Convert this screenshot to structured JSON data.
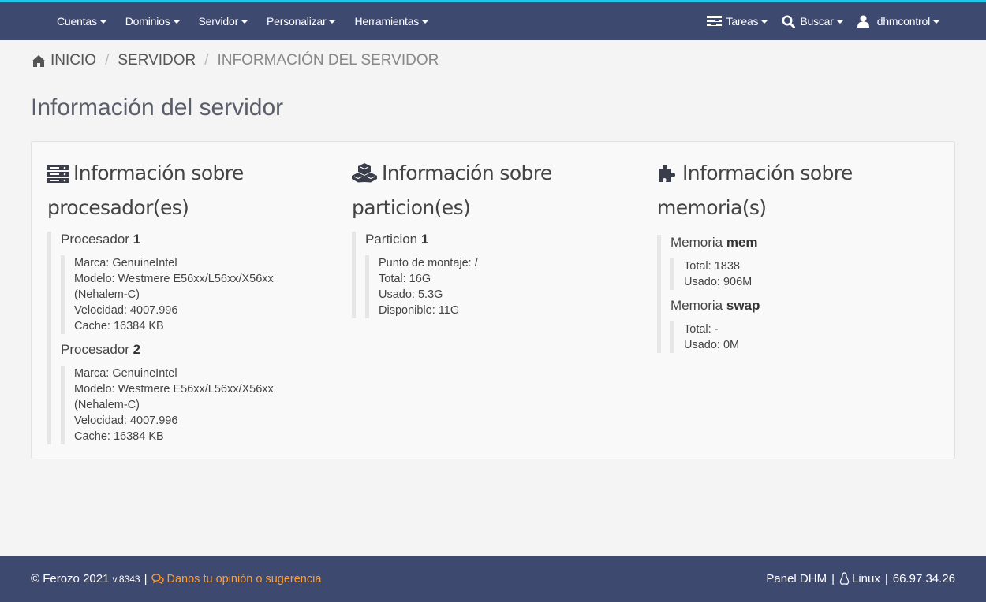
{
  "nav": {
    "left_items": [
      {
        "label": "Cuentas"
      },
      {
        "label": "Dominios"
      },
      {
        "label": "Servidor"
      },
      {
        "label": "Personalizar"
      },
      {
        "label": "Herramientas"
      }
    ],
    "tasks_label": "Tareas",
    "search_label": "Buscar",
    "user_label": "dhmcontrol",
    "accent_color": "#1fc8e6",
    "bar_color": "#3e4970"
  },
  "breadcrumb": {
    "home": "INICIO",
    "section": "SERVIDOR",
    "current": "INFORMACIÓN DEL SERVIDOR"
  },
  "page_title": "Información del servidor",
  "processors": {
    "title": "Información sobre procesador(es)",
    "icon": "server-icon",
    "items": [
      {
        "prefix": "Procesador",
        "number": "1",
        "brand": "Marca: GenuineIntel",
        "model": "Modelo: Westmere E56xx/L56xx/X56xx (Nehalem-C)",
        "speed": "Velocidad: 4007.996",
        "cache": "Cache: 16384 KB"
      },
      {
        "prefix": "Procesador",
        "number": "2",
        "brand": "Marca: GenuineIntel",
        "model": "Modelo: Westmere E56xx/L56xx/X56xx (Nehalem-C)",
        "speed": "Velocidad: 4007.996",
        "cache": "Cache: 16384 KB"
      }
    ]
  },
  "partitions": {
    "title": "Información sobre particion(es)",
    "icon": "cubes-icon",
    "items": [
      {
        "prefix": "Particion",
        "number": "1",
        "mount": "Punto de montaje: /",
        "total": "Total: 16G",
        "used": "Usado: 5.3G",
        "available": "Disponible: 11G"
      }
    ]
  },
  "memory": {
    "title": "Información sobre memoria(s)",
    "icon": "puzzle-icon",
    "items": [
      {
        "prefix": "Memoria",
        "name": "mem",
        "total": "Total: 1838",
        "used": "Usado: 906M"
      },
      {
        "prefix": "Memoria",
        "name": "swap",
        "total": "Total: -",
        "used": "Usado: 0M"
      }
    ]
  },
  "footer": {
    "copyright": "© Ferozo 2021",
    "version": "v.8343",
    "separator": "|",
    "feedback": "Danos tu opinión o sugerencia",
    "panel": "Panel DHM",
    "os": "Linux",
    "ip": "66.97.34.26",
    "link_color": "#ff9d2e"
  }
}
